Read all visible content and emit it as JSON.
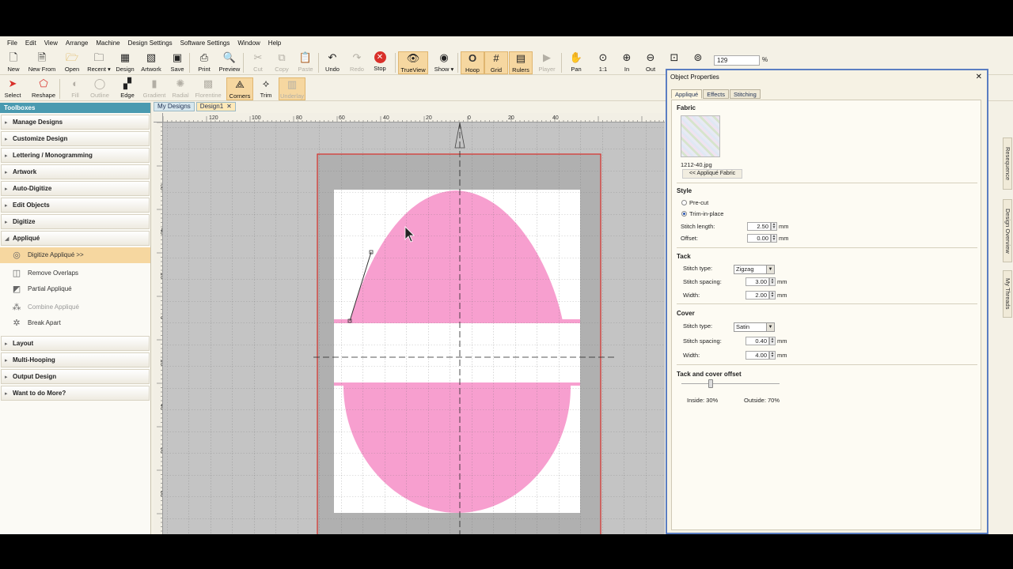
{
  "menu": [
    "File",
    "Edit",
    "View",
    "Arrange",
    "Machine",
    "Design Settings",
    "Software Settings",
    "Window",
    "Help"
  ],
  "toolbar1": [
    {
      "label": "New",
      "icon": "new-icon"
    },
    {
      "label": "New From",
      "icon": "new-from-icon"
    },
    {
      "label": "Open",
      "icon": "open-icon"
    },
    {
      "label": "Recent ▾",
      "icon": "recent-icon"
    },
    {
      "label": "Design",
      "icon": "design-icon"
    },
    {
      "label": "Artwork",
      "icon": "artwork-icon"
    },
    {
      "label": "Save",
      "icon": "save-icon"
    },
    {
      "label": "Print",
      "icon": "print-icon"
    },
    {
      "label": "Preview",
      "icon": "preview-icon"
    },
    {
      "label": "Cut",
      "icon": "cut-icon"
    },
    {
      "label": "Copy",
      "icon": "copy-icon"
    },
    {
      "label": "Paste",
      "icon": "paste-icon"
    },
    {
      "label": "Undo",
      "icon": "undo-icon"
    },
    {
      "label": "Redo",
      "icon": "redo-icon"
    },
    {
      "label": "Stop",
      "icon": "stop-icon"
    },
    {
      "label": "TrueView",
      "icon": "trueview-icon"
    },
    {
      "label": "Show ▾",
      "icon": "show-icon"
    },
    {
      "label": "Hoop",
      "icon": "hoop-icon"
    },
    {
      "label": "Grid",
      "icon": "grid-icon"
    },
    {
      "label": "Rulers",
      "icon": "rulers-icon"
    },
    {
      "label": "Player",
      "icon": "player-icon"
    },
    {
      "label": "Pan",
      "icon": "pan-icon"
    },
    {
      "label": "1:1",
      "icon": "zoom-1to1-icon"
    },
    {
      "label": "In",
      "icon": "zoom-in-icon"
    },
    {
      "label": "Out",
      "icon": "zoom-out-icon"
    }
  ],
  "zoom": {
    "value": "129",
    "unit": "%"
  },
  "toolbar2": [
    {
      "label": "Select",
      "icon": "select-icon"
    },
    {
      "label": "Reshape",
      "icon": "reshape-icon"
    },
    {
      "label": "Fill",
      "icon": "fill-icon"
    },
    {
      "label": "Outline",
      "icon": "outline-icon"
    },
    {
      "label": "Edge",
      "icon": "edge-icon"
    },
    {
      "label": "Gradient",
      "icon": "gradient-icon"
    },
    {
      "label": "Radial",
      "icon": "radial-icon"
    },
    {
      "label": "Florentine",
      "icon": "florentine-icon"
    },
    {
      "label": "Corners",
      "icon": "corners-icon"
    },
    {
      "label": "Trim",
      "icon": "trim-icon"
    },
    {
      "label": "Underlay",
      "icon": "underlay-icon"
    }
  ],
  "toolbox": {
    "header": "Toolboxes",
    "categories_top": [
      "Manage Designs",
      "Customize Design",
      "Lettering / Monogramming",
      "Artwork",
      "Auto-Digitize",
      "Edit Objects",
      "Digitize"
    ],
    "open_category": "Appliqué",
    "items": [
      {
        "label": "Digitize Appliqué >>",
        "icon": "digitize-applique-icon"
      },
      {
        "label": "Remove Overlaps",
        "icon": "remove-overlaps-icon"
      },
      {
        "label": "Partial Appliqué",
        "icon": "partial-applique-icon"
      },
      {
        "label": "Combine Appliqué",
        "icon": "combine-applique-icon"
      },
      {
        "label": "Break Apart",
        "icon": "break-apart-icon"
      }
    ],
    "categories_bottom": [
      "Layout",
      "Multi-Hooping",
      "Output Design",
      "Want to do More?"
    ]
  },
  "tabs": [
    {
      "label": "My Designs"
    },
    {
      "label": "Design1"
    }
  ],
  "ruler_top": [
    "120",
    "100",
    "80",
    "60",
    "40",
    "20",
    "0",
    "20",
    "40"
  ],
  "ruler_left": [
    "80",
    "60",
    "40",
    "20",
    "0",
    "20",
    "40",
    "60",
    "80"
  ],
  "colors": {
    "fabric_pink": "#f79fcf",
    "hoop_red": "#d9302a",
    "panel_border": "#5b7ec2",
    "selected_bg": "#f6d7a0"
  },
  "props": {
    "title": "Object Properties",
    "tabs": [
      "Appliqué",
      "Effects",
      "Stitching"
    ],
    "fabric": {
      "heading": "Fabric",
      "filename": "1212-40.jpg",
      "button": "<< Appliqué Fabric"
    },
    "style": {
      "heading": "Style",
      "option1": "Pre-cut",
      "option2": "Trim-in-place",
      "stitch_length_label": "Stitch length:",
      "stitch_length": "2.50",
      "offset_label": "Offset:",
      "offset": "0.00",
      "unit": "mm"
    },
    "tack": {
      "heading": "Tack",
      "stitch_type_label": "Stitch type:",
      "stitch_type": "Zigzag",
      "spacing_label": "Stitch spacing:",
      "spacing": "3.00",
      "width_label": "Width:",
      "width": "2.00",
      "unit": "mm"
    },
    "cover": {
      "heading": "Cover",
      "stitch_type_label": "Stitch type:",
      "stitch_type": "Satin",
      "spacing_label": "Stitch spacing:",
      "spacing": "0.40",
      "width_label": "Width:",
      "width": "4.00",
      "unit": "mm"
    },
    "offset": {
      "heading": "Tack and cover offset",
      "inside": "Inside: 30%",
      "outside": "Outside: 70%",
      "inside_fraction": 0.3
    }
  },
  "right_tabs": [
    "Resequence",
    "Design Overview",
    "My Threads"
  ]
}
